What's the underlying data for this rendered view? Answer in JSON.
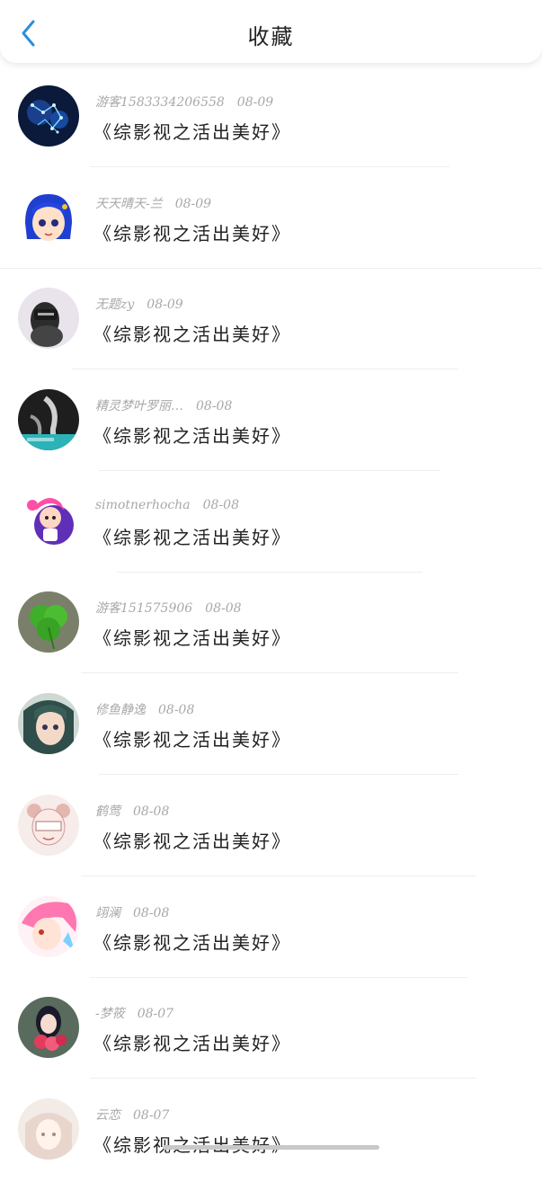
{
  "header": {
    "title": "收藏",
    "back_icon": "chevron-left-icon",
    "accent": "#2b8fdb"
  },
  "items": [
    {
      "user": "游客1583334206558",
      "date": "08-09",
      "book": "《综影视之活出美好》",
      "avatar": "constellation-avatar"
    },
    {
      "user": "天天晴天-兰",
      "date": "08-09",
      "book": "《综影视之活出美好》",
      "avatar": "anime-blue-hair-avatar"
    },
    {
      "user": "无题zy",
      "date": "08-09",
      "book": "《综影视之活出美好》",
      "avatar": "girl-photo-avatar"
    },
    {
      "user": "精灵梦叶罗丽…",
      "date": "08-08",
      "book": "《综影视之活出美好》",
      "avatar": "dark-photo-avatar"
    },
    {
      "user": "simotnerhocha",
      "date": "08-08",
      "book": "《综影视之活出美好》",
      "avatar": "pink-hair-cartoon-avatar"
    },
    {
      "user": "游客151575906",
      "date": "08-08",
      "book": "《综影视之活出美好》",
      "avatar": "clover-avatar"
    },
    {
      "user": "修鱼静逸",
      "date": "08-08",
      "book": "《综影视之活出美好》",
      "avatar": "anime-girl-avatar"
    },
    {
      "user": "鹤莺",
      "date": "08-08",
      "book": "《综影视之活出美好》",
      "avatar": "sketch-girl-avatar"
    },
    {
      "user": "翊澜",
      "date": "08-08",
      "book": "《综影视之活出美好》",
      "avatar": "pink-anime-avatar"
    },
    {
      "user": "-梦筱",
      "date": "08-07",
      "book": "《综影视之活出美好》",
      "avatar": "flower-girl-avatar"
    },
    {
      "user": "云恋",
      "date": "08-07",
      "book": "《综影视之活出美好》",
      "avatar": "pale-anime-avatar"
    }
  ]
}
